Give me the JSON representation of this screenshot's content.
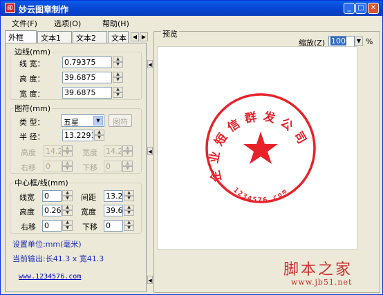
{
  "window": {
    "title": "妙云图章制作",
    "icon": "seal-app-icon"
  },
  "menu": [
    "文件(F)",
    "选项(O)",
    "帮助(H)"
  ],
  "tabs": [
    "外框",
    "文本1",
    "文本2",
    "文本"
  ],
  "border_group": {
    "legend": "边线(mm)",
    "line_width_label": "线 宽：",
    "line_width": "0.79375",
    "height_label": "高 度：",
    "height": "39.6875",
    "width_label": "宽 度：",
    "width": "39.6875"
  },
  "symbol_group": {
    "legend": "图符(mm)",
    "type_label": "类 型：",
    "type_value": "五星",
    "symbol_button": "图符",
    "radius_label": "半 径：",
    "radius": "13.2291",
    "height_label": "高度",
    "height": "14.2",
    "width_label": "宽度",
    "width": "14.2",
    "right_label": "右移",
    "right": "0",
    "down_label": "下移",
    "down": "0"
  },
  "center_group": {
    "legend": "中心框/线(mm)",
    "line_width_label": "线宽",
    "line_width": "0",
    "spacing_label": "间距",
    "spacing": "13.2",
    "height_label": "高度",
    "height": "0.26",
    "width_label": "宽度",
    "width": "39.6",
    "right_label": "右移",
    "right": "0",
    "down_label": "下移",
    "down": "0"
  },
  "unit_text": "设置单位:mm(毫米)",
  "output_text": "当前输出:长41.3 x 宽41.3",
  "website": "www.1234576.com",
  "preview": {
    "label": "预览",
    "zoom_label": "缩放(Z)",
    "zoom_value": "100",
    "zoom_unit": "%"
  },
  "stamp": {
    "arc_text": "企业短信群发公司",
    "bottom_text": "1234576.com",
    "color": "#e8222a"
  },
  "watermark": {
    "title": "脚本之家",
    "url": "www.jb51.net"
  }
}
